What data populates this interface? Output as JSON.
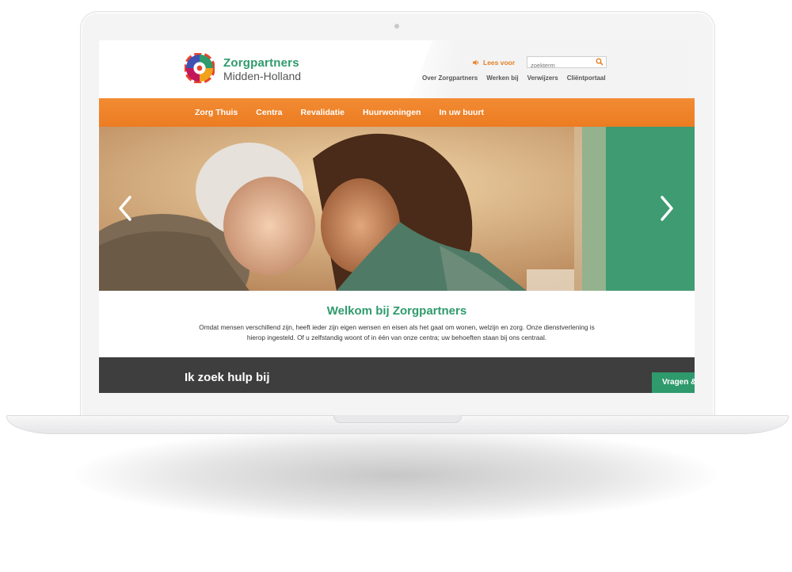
{
  "brand": {
    "line1": "Zorgpartners",
    "line2": "Midden-Holland"
  },
  "header": {
    "lees_voor": "Lees voor",
    "search_placeholder": "zoekterm",
    "links": [
      "Over Zorgpartners",
      "Werken bij",
      "Verwijzers",
      "Cliëntportaal"
    ]
  },
  "nav": {
    "items": [
      "Zorg Thuis",
      "Centra",
      "Revalidatie",
      "Huurwoningen",
      "In uw buurt"
    ]
  },
  "welcome": {
    "title": "Welkom bij Zorgpartners",
    "text": "Omdat mensen verschillend zijn, heeft ieder zijn eigen wensen en eisen als het gaat om wonen, welzijn en zorg. Onze dienstverlening is hierop ingesteld. Of u zelfstandig woont of in één van onze centra; uw behoeften staan bij ons centraal."
  },
  "help": {
    "title": "Ik zoek hulp bij",
    "vragen_label": "Vragen &"
  },
  "colors": {
    "orange": "#ec7c22",
    "green": "#2f9a6c",
    "dark": "#3e3e3e"
  }
}
